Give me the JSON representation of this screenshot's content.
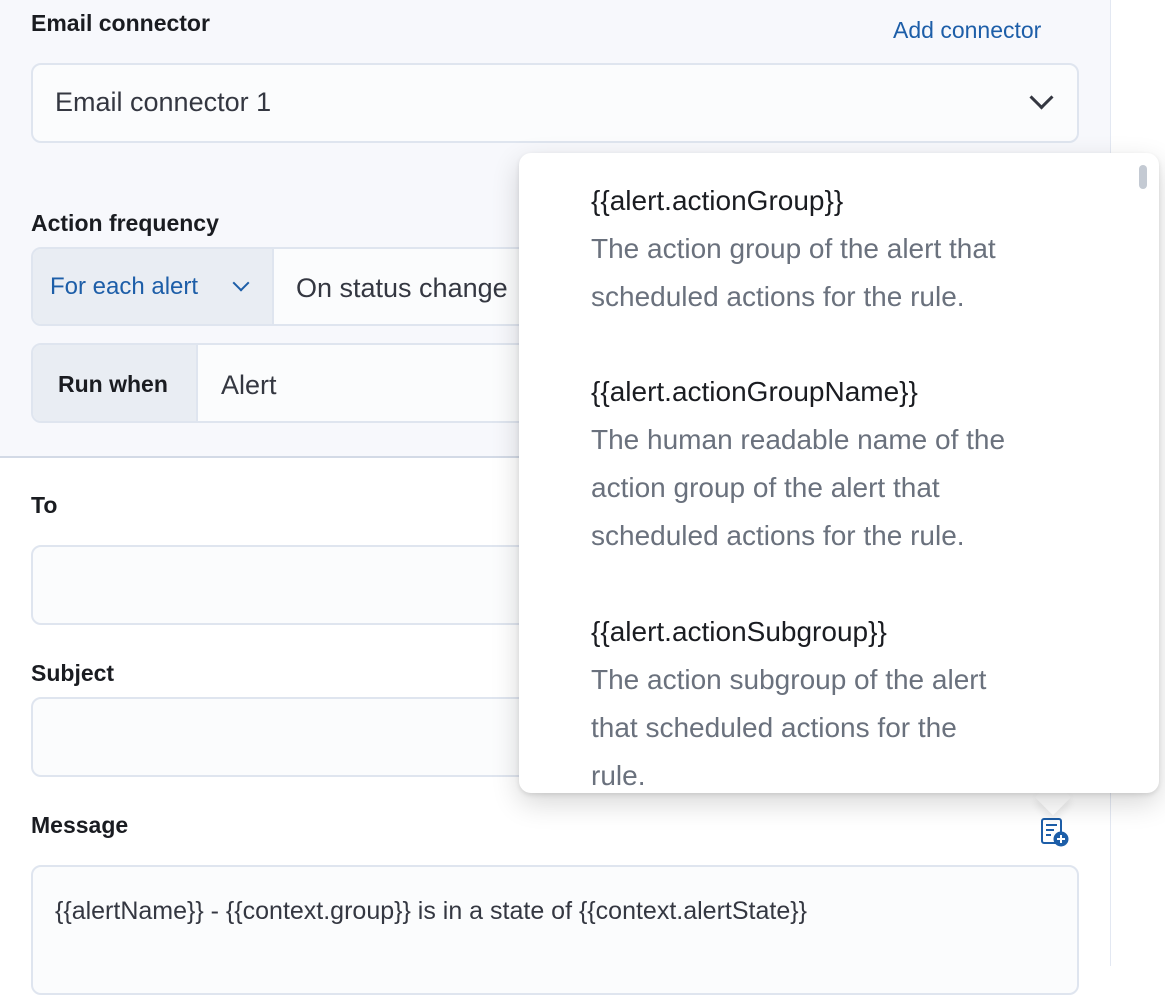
{
  "connector": {
    "label": "Email connector",
    "add_link": "Add connector",
    "selected": "Email connector 1"
  },
  "frequency": {
    "label": "Action frequency",
    "mode": "For each alert",
    "trigger": "On status change"
  },
  "run_when": {
    "prepend": "Run when",
    "value": "Alert"
  },
  "to": {
    "label": "To",
    "value": ""
  },
  "subject": {
    "label": "Subject",
    "value": ""
  },
  "message": {
    "label": "Message",
    "value": "{{alertName}} - {{context.group}} is in a state of {{context.alertState}}",
    "variables_icon": "add-variable-icon"
  },
  "variables_popover": {
    "items": [
      {
        "name": "{{alert.actionGroup}}",
        "desc_lines": [
          "The action group of the alert that",
          "scheduled actions for the rule."
        ]
      },
      {
        "name": "{{alert.actionGroupName}}",
        "desc_lines": [
          "The human readable name of the",
          "action group of the alert that",
          "scheduled actions for the rule."
        ]
      },
      {
        "name": "{{alert.actionSubgroup}}",
        "desc_lines": [
          "The action subgroup of the alert",
          "that scheduled actions for the",
          "rule."
        ]
      }
    ]
  },
  "colors": {
    "accent": "#1d5ea8",
    "panel_bg": "#f7f8fc",
    "border": "#dfe5ef"
  }
}
